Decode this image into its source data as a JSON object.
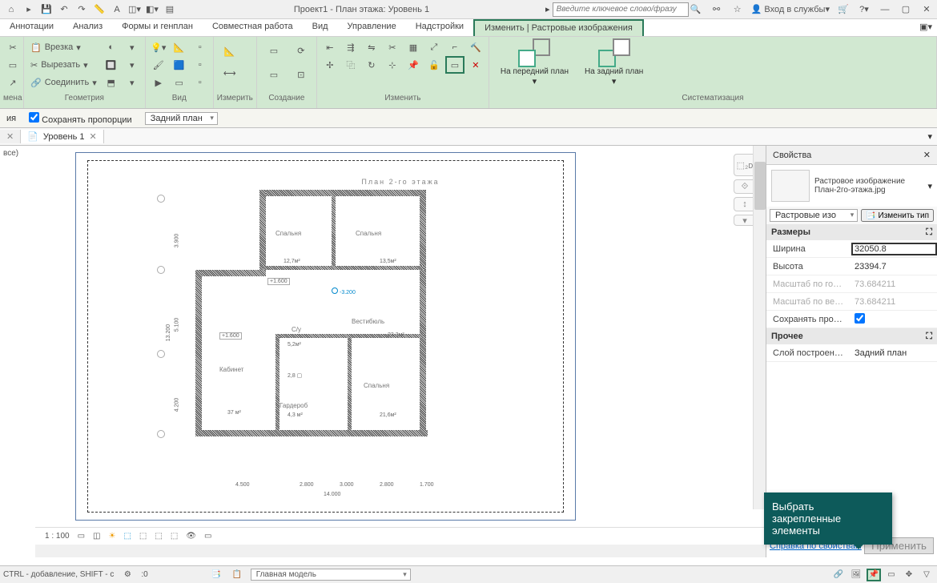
{
  "titlebar": {
    "title": "Проект1 - План этажа: Уровень 1",
    "search_placeholder": "Введите ключевое слово/фразу",
    "login": "Вход в службы"
  },
  "tabs": {
    "annotations": "Аннотации",
    "analysis": "Анализ",
    "forms": "Формы и генплан",
    "collab": "Совместная работа",
    "view": "Вид",
    "manage": "Управление",
    "addins": "Надстройки",
    "modify": "Изменить | Растровые изображения"
  },
  "ribbon": {
    "cut": "Вырезать",
    "paste": "Врезка",
    "join": "Соединить",
    "group_geom": "Геометрия",
    "group_view": "Вид",
    "group_measure": "Измерить",
    "group_create": "Создание",
    "group_modify": "Изменить",
    "group_arrange": "Систематизация",
    "front": "На передний план",
    "back": "На задний план",
    "mena": "мена"
  },
  "options": {
    "ya": "ия",
    "keep_prop": "Сохранять пропорции",
    "back_plan": "Задний план"
  },
  "doc_tab": {
    "level1": "Уровень 1"
  },
  "left_label": "все)",
  "canvas": {
    "title": "План 2-го этажа",
    "rooms": {
      "bedroom1": "Спальня",
      "bedroom2": "Спальня",
      "bedroom3": "Спальня",
      "vestibule": "Вестибюль",
      "cabinet": "Кабинет",
      "garderobe": "Гардероб",
      "su": "С/у"
    },
    "dims": {
      "d1": "3.900",
      "d2": "5.100",
      "d3": "4.200",
      "d4": "13.200",
      "d5": "4.500",
      "d6": "2.800",
      "d7": "3.000",
      "d8": "2.800",
      "d9": "1.700",
      "d10": "14.000",
      "a1": "12,7м²",
      "a2": "13,5м²",
      "a3": "22,3м²",
      "a4": "37 м²",
      "a5": "4,3 м²",
      "a6": "21,6м²",
      "a7": "5,2м²",
      "a8": "2,8 ▢",
      "lvl1": "+1.600",
      "lvl2": "+1.600",
      "lvl3": "-3.200"
    },
    "scale": "1 : 100"
  },
  "props": {
    "title": "Свойства",
    "type_name": "Растровое изображение\nПлан-2го-этажа.jpg",
    "filter": "Растровые изо",
    "edit_type": "Изменить тип",
    "cat_dim": "Размеры",
    "width": "Ширина",
    "width_v": "32050.8",
    "height": "Высота",
    "height_v": "23394.7",
    "scale_h": "Масштаб по го…",
    "scale_h_v": "73.684211",
    "scale_v": "Масштаб по ве…",
    "scale_v_v": "73.684211",
    "keep": "Сохранять про…",
    "cat_other": "Прочее",
    "layer": "Слой построен…",
    "layer_v": "Задний план",
    "help": "Справка по свойствам",
    "apply": "Применить"
  },
  "tooltip": "Выбрать закрепленные элементы",
  "status": {
    "hint": "CTRL - добавление, SHIFT - с",
    "zero": ":0",
    "main_model": "Главная модель"
  }
}
